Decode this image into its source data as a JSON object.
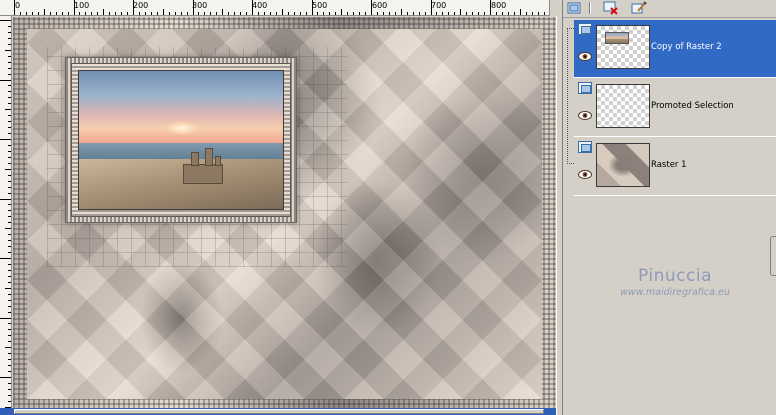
{
  "ruler": {
    "labels": [
      "0",
      "100",
      "200",
      "300",
      "400",
      "500",
      "600",
      "700",
      "800"
    ]
  },
  "layers": [
    {
      "name": "Copy of Raster 2",
      "selected": true,
      "visible": true
    },
    {
      "name": "Promoted Selection",
      "selected": false,
      "visible": true
    },
    {
      "name": "Raster 1",
      "selected": false,
      "visible": true
    }
  ],
  "watermark": {
    "title": "Pinuccia",
    "url": "www.maidiregrafica.eu"
  },
  "icons": {
    "toolbar": [
      "new-layer-icon",
      "delete-layer-icon",
      "edit-layer-icon"
    ],
    "layer_type": "raster-layer-icon",
    "visibility": "eye-icon"
  },
  "colors": {
    "selection": "#316ac5",
    "panel_bg": "#d4d0c8",
    "watermark": "#8f99b8"
  }
}
